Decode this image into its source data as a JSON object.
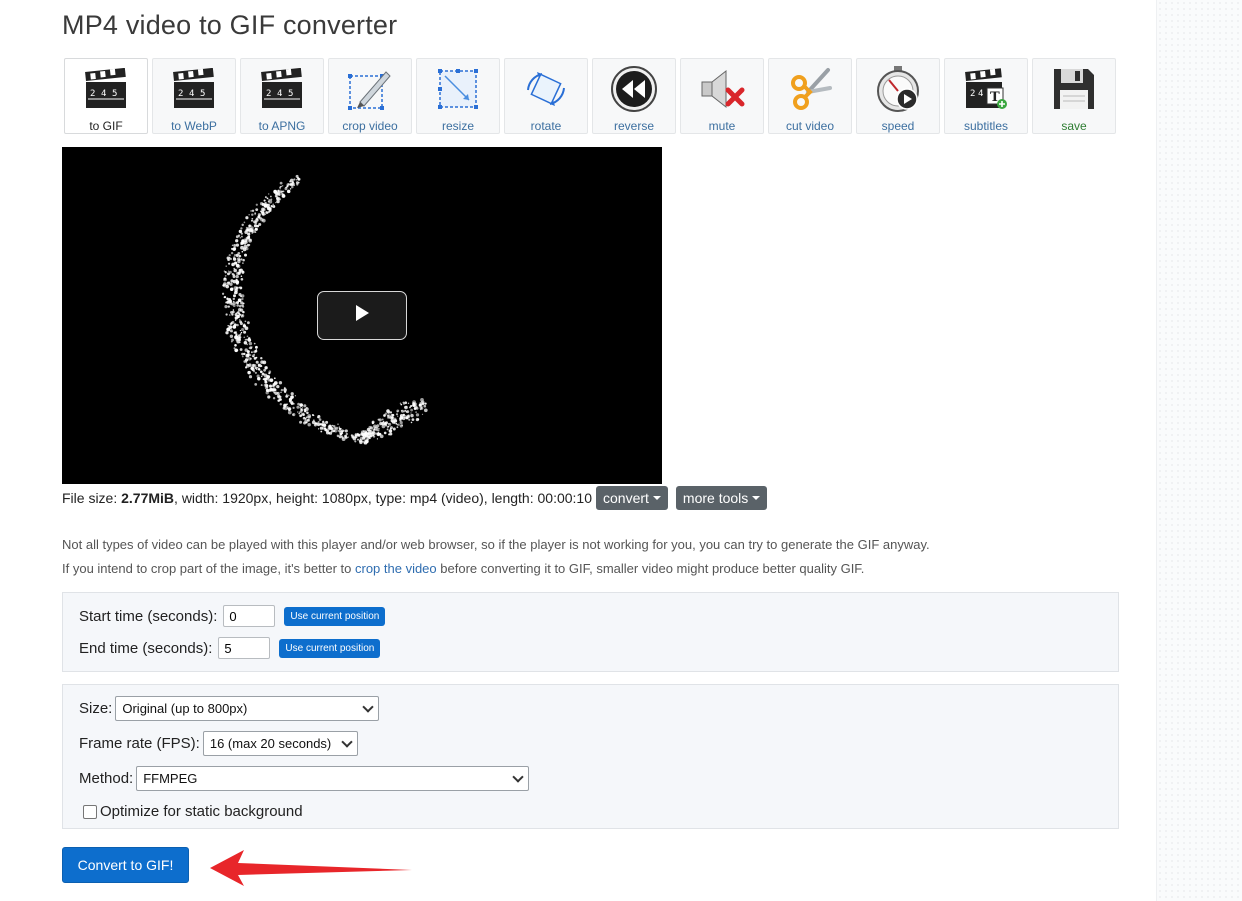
{
  "title": "MP4 video to GIF converter",
  "toolbar": {
    "tools": [
      {
        "label": "to GIF",
        "icon": "clapperboard-icon",
        "active": true
      },
      {
        "label": "to WebP",
        "icon": "clapperboard-icon"
      },
      {
        "label": "to APNG",
        "icon": "clapperboard-icon"
      },
      {
        "label": "crop video",
        "icon": "crop-icon"
      },
      {
        "label": "resize",
        "icon": "resize-icon"
      },
      {
        "label": "rotate",
        "icon": "rotate-icon"
      },
      {
        "label": "reverse",
        "icon": "rewind-icon"
      },
      {
        "label": "mute",
        "icon": "mute-speaker-icon"
      },
      {
        "label": "cut video",
        "icon": "scissors-icon"
      },
      {
        "label": "speed",
        "icon": "stopwatch-icon"
      },
      {
        "label": "subtitles",
        "icon": "subtitles-clapperboard-icon"
      },
      {
        "label": "save",
        "icon": "floppy-disk-icon"
      }
    ]
  },
  "fileinfo": {
    "prefix": "File size: ",
    "size": "2.77MiB",
    "rest": ", width: 1920px, height: 1080px, type: mp4 (video), length: 00:00:10",
    "convert_label": "convert",
    "more_tools_label": "more tools"
  },
  "notes": {
    "line1": "Not all types of video can be played with this player and/or web browser, so if the player is not working for you, you can try to generate the GIF anyway.",
    "line2_before": "If you intend to crop part of the image, it's better to ",
    "line2_link": "crop the video",
    "line2_after": " before converting it to GIF, smaller video might produce better quality GIF."
  },
  "time_panel": {
    "start_label": "Start time (seconds):",
    "start_value": "0",
    "end_label": "End time (seconds):",
    "end_value": "5",
    "use_current_label": "Use current position"
  },
  "options_panel": {
    "size_label": "Size:",
    "size_value": "Original (up to 800px)",
    "fps_label": "Frame rate (FPS):",
    "fps_value": "16 (max 20 seconds)",
    "method_label": "Method:",
    "method_value": "FFMPEG",
    "optimize_label": "Optimize for static background",
    "optimize_checked": false
  },
  "convert_button_label": "Convert to GIF!",
  "colors": {
    "primary": "#0d6ecd",
    "secondary_button": "#5a6268",
    "annotation_arrow": "#e8262a"
  }
}
